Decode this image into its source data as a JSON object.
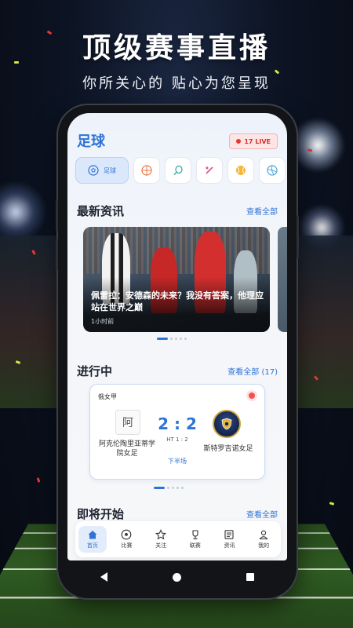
{
  "promo": {
    "title": "顶级赛事直播",
    "subtitle": "你所关心的 贴心为您呈现"
  },
  "header": {
    "title": "足球",
    "live_count": "17 LIVE"
  },
  "sports_filter": {
    "active_label": "足球",
    "icons": [
      "football-icon",
      "basketball-icon",
      "tennis-icon",
      "badminton-icon",
      "baseball-icon",
      "volleyball-icon"
    ]
  },
  "news": {
    "title": "最新资讯",
    "see_all": "查看全部",
    "headline": "佩雷拉：安德森的未来？我没有答案，他理应站在世界之巅",
    "time": "1小时前"
  },
  "live_section": {
    "title": "进行中",
    "see_all": "查看全部 (17)"
  },
  "match": {
    "league": "俄女甲",
    "home_logo_text": "阿",
    "home_team": "阿克伦陶里亚蒂学院女足",
    "away_team": "斯特罗吉诺女足",
    "score": "2 : 2",
    "halftime": "HT 1 : 2",
    "period": "下半场"
  },
  "upcoming": {
    "title": "即将开始",
    "see_all": "查看全部"
  },
  "tabbar": {
    "items": [
      {
        "label": "首页",
        "icon": "home-icon",
        "active": true
      },
      {
        "label": "比赛",
        "icon": "soccer-ball-icon",
        "active": false
      },
      {
        "label": "关注",
        "icon": "star-icon",
        "active": false
      },
      {
        "label": "联赛",
        "icon": "trophy-icon",
        "active": false
      },
      {
        "label": "资讯",
        "icon": "news-icon",
        "active": false
      },
      {
        "label": "我的",
        "icon": "user-icon",
        "active": false
      }
    ]
  },
  "colors": {
    "accent": "#2f73d6",
    "live_red": "#e53935"
  }
}
